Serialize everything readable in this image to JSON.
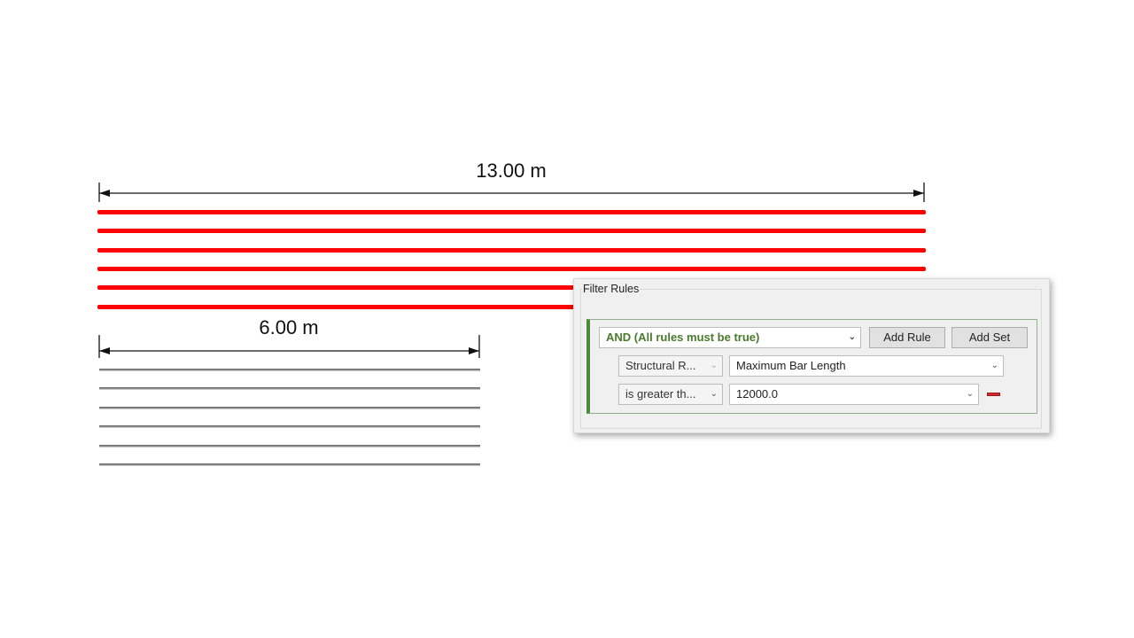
{
  "dimensions": {
    "long": {
      "label": "13.00 m"
    },
    "short": {
      "label": "6.00 m"
    }
  },
  "bars": {
    "long_count": 6,
    "long_color": "#ff0000",
    "short_count": 6,
    "short_color": "#8a8a8a"
  },
  "filter_rules": {
    "group_title": "Filter Rules",
    "rule_set": {
      "operator": "AND (All rules must be true)",
      "add_rule_label": "Add Rule",
      "add_set_label": "Add Set"
    },
    "rule": {
      "category": "Structural R...",
      "parameter": "Maximum Bar Length",
      "condition": "is greater th...",
      "value": "12000.0"
    },
    "accent_color": "#4e8a3e"
  },
  "icons": {
    "dropdown": "chevron-down-icon",
    "remove": "minus-icon"
  }
}
